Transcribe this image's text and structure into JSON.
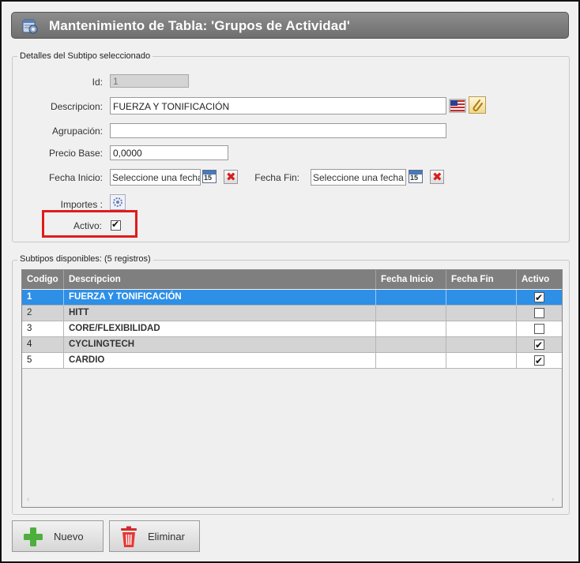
{
  "window": {
    "title": "Mantenimiento de Tabla: 'Grupos de Actividad'",
    "title_icon": "gear-table-icon"
  },
  "details": {
    "legend": "Detalles del Subtipo seleccionado",
    "id_label": "Id:",
    "id_value": "1",
    "descripcion_label": "Descripcion:",
    "descripcion_value": "FUERZA Y TONIFICACIÓN",
    "agrupacion_label": "Agrupación:",
    "agrupacion_value": "",
    "precio_label": "Precio Base:",
    "precio_value": "0,0000",
    "fecha_inicio_label": "Fecha Inicio:",
    "fecha_inicio_placeholder": "Seleccione una fecha",
    "fecha_fin_label": "Fecha Fin:",
    "fecha_fin_placeholder": "Seleccione una fecha",
    "calendar_day": "15",
    "importes_label": "Importes :",
    "activo_label": "Activo:",
    "activo_checked": true
  },
  "subtipos": {
    "legend": "Subtipos disponibles:  (5 registros)",
    "columns": [
      "Codigo",
      "Descripcion",
      "Fecha Inicio",
      "Fecha Fin",
      "Activo"
    ],
    "rows": [
      {
        "codigo": "1",
        "descripcion": "FUERZA Y TONIFICACIÓN",
        "fecha_inicio": "",
        "fecha_fin": "",
        "activo": true,
        "selected": true
      },
      {
        "codigo": "2",
        "descripcion": "HITT",
        "fecha_inicio": "",
        "fecha_fin": "",
        "activo": false
      },
      {
        "codigo": "3",
        "descripcion": "CORE/FLEXIBILIDAD",
        "fecha_inicio": "",
        "fecha_fin": "",
        "activo": false
      },
      {
        "codigo": "4",
        "descripcion": "CYCLINGTECH",
        "fecha_inicio": "",
        "fecha_fin": "",
        "activo": true
      },
      {
        "codigo": "5",
        "descripcion": "CARDIO",
        "fecha_inicio": "",
        "fecha_fin": "",
        "activo": true
      }
    ],
    "scroll_left": "‹",
    "scroll_right": "›"
  },
  "buttons": {
    "nuevo": "Nuevo",
    "eliminar": "Eliminar"
  },
  "colors": {
    "selected_row": "#2e8fe6",
    "highlight_box": "#e01b1b",
    "title_bar": "#7f7f7f"
  }
}
